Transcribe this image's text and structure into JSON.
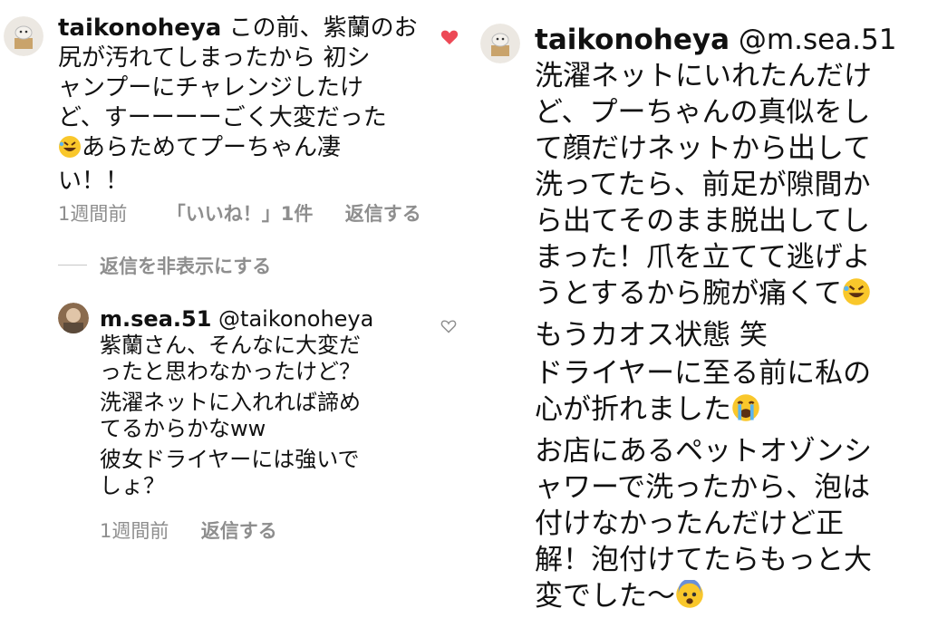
{
  "left_comment": {
    "username": "taikonoheya",
    "lines": [
      "この前、紫蘭のお",
      "尻が汚れてしまったから 初シ",
      "ャンプーにチャレンジしたけ",
      "ど、すーーーーごく大変だった",
      "あらためてプーちゃん凄",
      "い！！"
    ],
    "meta": {
      "time": "1週間前",
      "likes": "「いいね！」1件",
      "reply": "返信する"
    },
    "hide_replies": "返信を非表示にする",
    "liked": true,
    "heart_color": "#ed4956"
  },
  "reply_comment": {
    "username": "m.sea.51",
    "mention": "@taikonoheya",
    "lines": [
      "紫蘭さん、そんなに大変だ",
      "ったと思わなかったけど？",
      "洗濯ネットに入れれば諦め",
      "てるからかなww",
      "彼女ドライヤーには強いで",
      "しょ？"
    ],
    "meta": {
      "time": "1週間前",
      "reply": "返信する"
    }
  },
  "right_comment": {
    "username": "taikonoheya",
    "mention": "@m.sea.51",
    "lines": [
      "洗濯ネットにいれたんだけ",
      "ど、プーちゃんの真似をし",
      "て顔だけネットから出して",
      "洗ってたら、前足が隙間か",
      "ら出てそのまま脱出してし",
      "まった！爪を立てて逃げよ",
      "うとするから腕が痛くて",
      "もうカオス状態 笑",
      "ドライヤーに至る前に私の",
      "心が折れました",
      "お店にあるペットオゾンシ",
      "ャワーで洗ったから、泡は",
      "付けなかったんだけど正",
      "解！泡付けてたらもっと大",
      "変でした〜"
    ]
  },
  "colors": {
    "meta_gray": "#8e8e8e",
    "heart_red": "#ed4956",
    "text": "#111111"
  },
  "icons": [
    "rofl-emoji",
    "crying-emoji",
    "fearful-emoji",
    "heart-icon",
    "heart-outline-icon"
  ]
}
